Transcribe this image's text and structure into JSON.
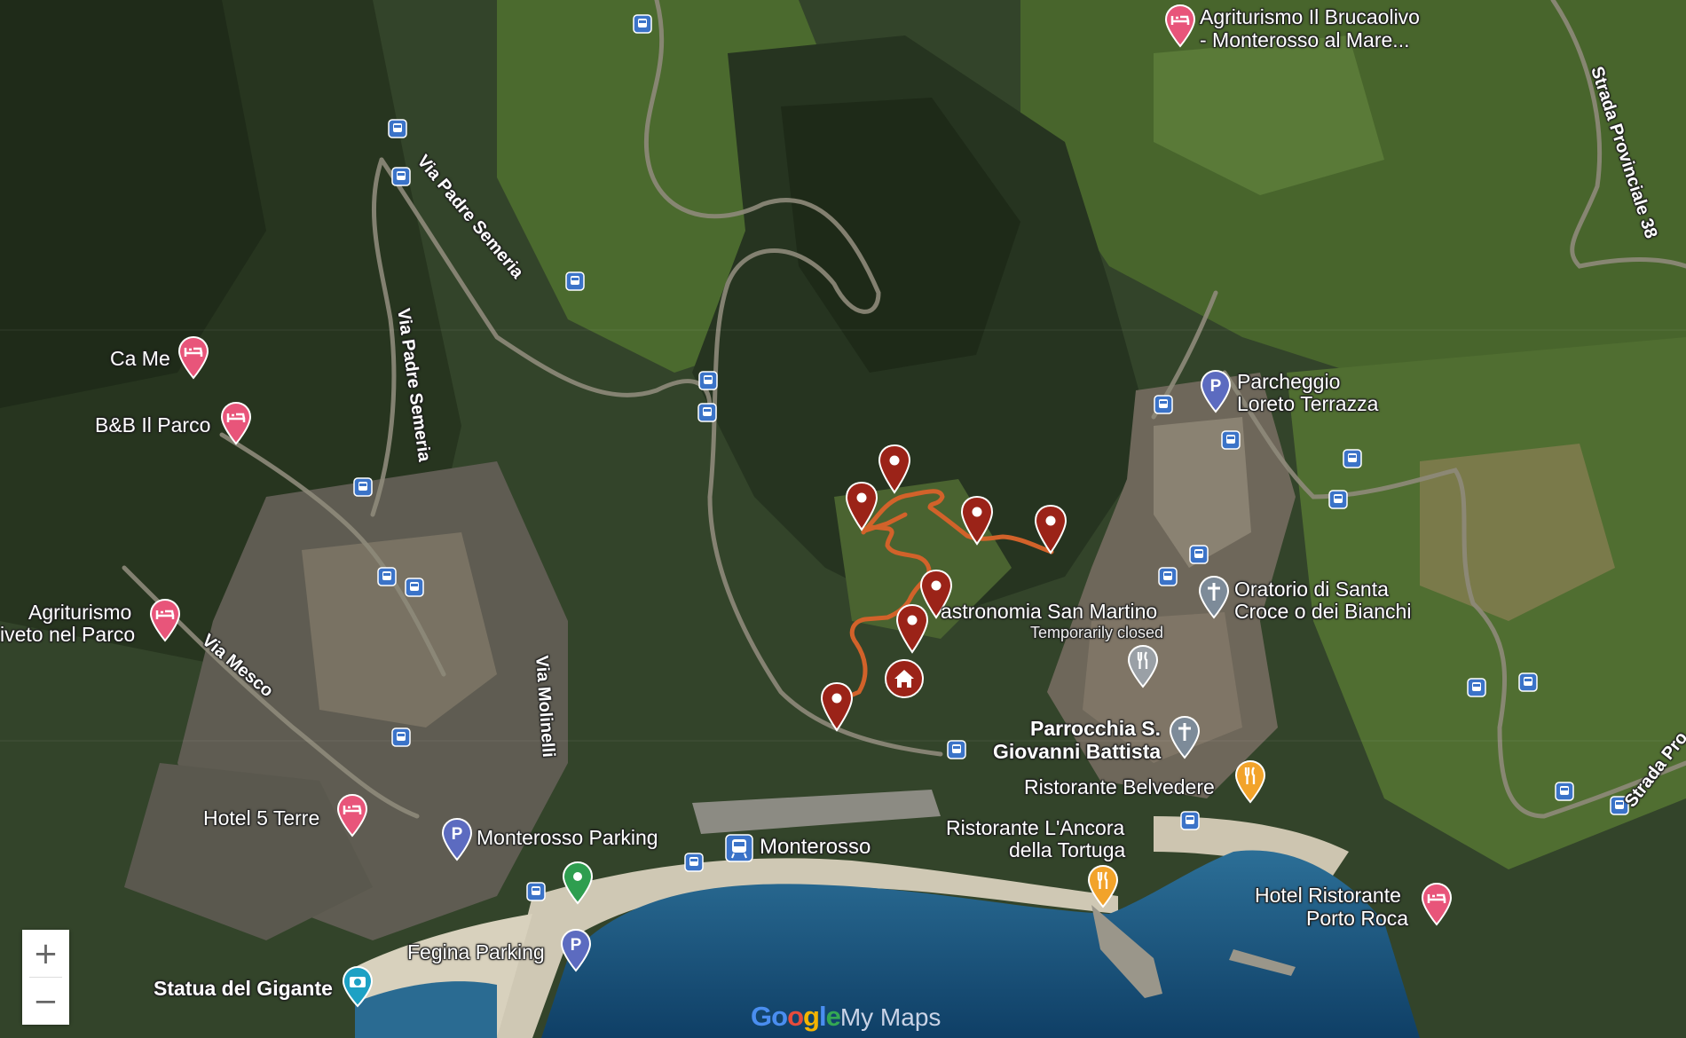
{
  "labels": {
    "brucaolivo": "Agriturismo Il Brucaolivo",
    "brucaolivo2": "- Monterosso al Mare...",
    "sp38": "Strada Provinciale 38",
    "sp_short": "Strada Pro",
    "ca_me": "Ca Me",
    "bb_parco": "B&B Il Parco",
    "padre_semeria_1": "Via Padre Semeria",
    "padre_semeria_2": "Via Padre Semeria",
    "parcheggio_loreto": "Parcheggio",
    "parcheggio_loreto2": "Loreto Terrazza",
    "agriturismo_oliveto": "Agriturismo",
    "agriturismo_oliveto2": "iveto nel Parco",
    "via_mesco": "Via Mesco",
    "via_molinelli": "Via Molinelli",
    "gastronomia": "astronomia San Martino",
    "temporarily_closed": "Temporarily closed",
    "oratorio": "Oratorio di Santa",
    "oratorio2": "Croce o dei Bianchi",
    "parrocchia": "Parrocchia S.",
    "parrocchia2": "Giovanni Battista",
    "belvedere": "Ristorante Belvedere",
    "hotel_5_terre": "Hotel 5 Terre",
    "monterosso_parking": "Monterosso Parking",
    "monterosso": "Monterosso",
    "ancora": "Ristorante L'Ancora",
    "ancora2": "della Tortuga",
    "hotel_roca": "Hotel Ristorante",
    "hotel_roca2": "Porto Roca",
    "fegina_parking": "Fegina Parking",
    "statua_gigante": "Statua del Gigante"
  },
  "controls": {
    "zoom_in": "+",
    "zoom_out": "−"
  },
  "logo": {
    "g1": "Go",
    "g2": "o",
    "g3": "g",
    "g4": "l",
    "g5": "e",
    "product": "My Maps"
  },
  "colors": {
    "route": "#d2622a",
    "marker": "#9b2318",
    "hotel_pin": "#e8557a",
    "parking_pin": "#5c6bc0",
    "food_pin": "#f2a32a",
    "church_pin": "#7d8b99"
  },
  "markers": [
    "route-marker",
    "route-marker",
    "route-marker",
    "route-marker",
    "route-marker",
    "route-marker",
    "route-marker",
    "home-marker"
  ]
}
